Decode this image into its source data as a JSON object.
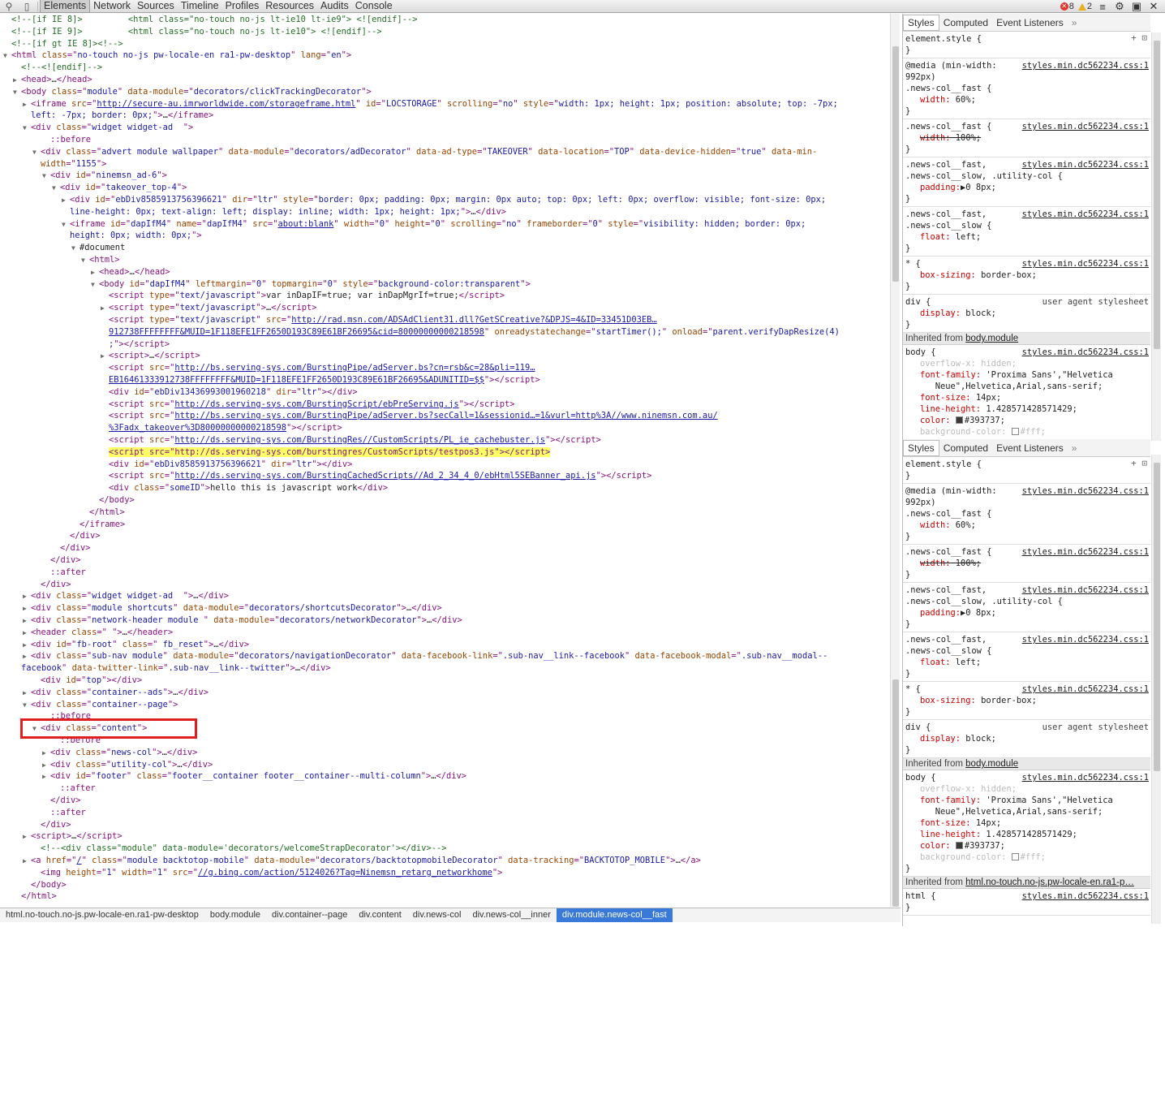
{
  "toolbar": {
    "tabs": [
      "Elements",
      "Network",
      "Sources",
      "Timeline",
      "Profiles",
      "Resources",
      "Audits",
      "Console"
    ],
    "errors": "8",
    "warnings": "2"
  },
  "tree": [
    {
      "t": 0,
      "i": 0,
      "h": "<span class=\"cmt\">&lt;!--[if IE 8]&gt;         &lt;html class=\"no-touch no-js lt-ie10 lt-ie9\"&gt; &lt;![endif]--&gt;</span>"
    },
    {
      "t": 0,
      "i": 0,
      "h": "<span class=\"cmt\">&lt;!--[if IE 9]&gt;         &lt;html class=\"no-touch no-js lt-ie10\"&gt; &lt;![endif]--&gt;</span>"
    },
    {
      "t": 0,
      "i": 0,
      "h": "<span class=\"cmt\">&lt;!--[if gt IE 8]&gt;&lt;!--&gt;</span>"
    },
    {
      "t": 2,
      "i": 0,
      "h": "&lt;html <span class=\"an\">class</span>=\"<span class=\"av\">no-touch no-js pw-locale-en ra1-pw-desktop</span>\" <span class=\"an\">lang</span>=\"<span class=\"av\">en</span>\"&gt;"
    },
    {
      "t": 0,
      "i": 1,
      "h": "<span class=\"cmt\">&lt;!--&lt;![endif]--&gt;</span>"
    },
    {
      "t": 1,
      "i": 1,
      "h": "&lt;head&gt;<span class=\"txt\">…</span>&lt;/head&gt;"
    },
    {
      "t": 2,
      "i": 1,
      "h": "&lt;body <span class=\"an\">class</span>=\"<span class=\"av\">module</span>\" <span class=\"an\">data-module</span>=\"<span class=\"av\">decorators/clickTrackingDecorator</span>\"&gt;"
    },
    {
      "t": 1,
      "i": 2,
      "h": "&lt;iframe <span class=\"an\">src</span>=\"<span class=\"lnk\">http://secure-au.imrworldwide.com/storageframe.html</span>\" <span class=\"an\">id</span>=\"<span class=\"av\">LOCSTORAGE</span>\" <span class=\"an\">scrolling</span>=\"<span class=\"av\">no</span>\" <span class=\"an\">style</span>=\"<span class=\"av\">width: 1px; height: 1px; position: absolute; top: -7px;</span>"
    },
    {
      "t": 0,
      "i": 2,
      "h": "<span class=\"av\">left: -7px; border: 0px;</span>\"&gt;<span class=\"txt\">…</span>&lt;/iframe&gt;"
    },
    {
      "t": 2,
      "i": 2,
      "h": "&lt;div <span class=\"an\">class</span>=\"<span class=\"av\">widget widget-ad  </span>\"&gt;"
    },
    {
      "t": 0,
      "i": 4,
      "h": "<span class=\"pseudo\">::before</span>"
    },
    {
      "t": 2,
      "i": 3,
      "h": "&lt;div <span class=\"an\">class</span>=\"<span class=\"av\">advert module wallpaper</span>\" <span class=\"an\">data-module</span>=\"<span class=\"av\">decorators/adDecorator</span>\" <span class=\"an\">data-ad-type</span>=\"<span class=\"av\">TAKEOVER</span>\" <span class=\"an\">data-location</span>=\"<span class=\"av\">TOP</span>\" <span class=\"an\">data-device-hidden</span>=\"<span class=\"av\">true</span>\" <span class=\"an\">data-min-</span>"
    },
    {
      "t": 0,
      "i": 3,
      "h": "<span class=\"an\">width</span>=\"<span class=\"av\">1155</span>\"&gt;"
    },
    {
      "t": 2,
      "i": 4,
      "h": "&lt;div <span class=\"an\">id</span>=\"<span class=\"av\">ninemsn_ad-6</span>\"&gt;"
    },
    {
      "t": 2,
      "i": 5,
      "h": "&lt;div <span class=\"an\">id</span>=\"<span class=\"av\">takeover_top-4</span>\"&gt;"
    },
    {
      "t": 1,
      "i": 6,
      "h": "&lt;div <span class=\"an\">id</span>=\"<span class=\"av\">ebDiv8585913756396621</span>\" <span class=\"an\">dir</span>=\"<span class=\"av\">ltr</span>\" <span class=\"an\">style</span>=\"<span class=\"av\">border: 0px; padding: 0px; margin: 0px auto; top: 0px; left: 0px; overflow: visible; font-size: 0px;</span>"
    },
    {
      "t": 0,
      "i": 6,
      "h": "<span class=\"av\">line-height: 0px; text-align: left; display: inline; width: 1px; height: 1px;</span>\"&gt;<span class=\"txt\">…</span>&lt;/div&gt;"
    },
    {
      "t": 2,
      "i": 6,
      "h": "&lt;iframe <span class=\"an\">id</span>=\"<span class=\"av\">dapIfM4</span>\" <span class=\"an\">name</span>=\"<span class=\"av\">dapIfM4</span>\" <span class=\"an\">src</span>=\"<span class=\"lnk\">about:blank</span>\" <span class=\"an\">width</span>=\"<span class=\"av\">0</span>\" <span class=\"an\">height</span>=\"<span class=\"av\">0</span>\" <span class=\"an\">scrolling</span>=\"<span class=\"av\">no</span>\" <span class=\"an\">frameborder</span>=\"<span class=\"av\">0</span>\" <span class=\"an\">style</span>=\"<span class=\"av\">visibility: hidden; border: 0px;</span>"
    },
    {
      "t": 0,
      "i": 6,
      "h": "<span class=\"av\">height: 0px; width: 0px;</span>\"&gt;"
    },
    {
      "t": 2,
      "i": 7,
      "h": "<span class=\"txt\">#document</span>"
    },
    {
      "t": 2,
      "i": 8,
      "h": "&lt;html&gt;"
    },
    {
      "t": 1,
      "i": 9,
      "h": "&lt;head&gt;<span class=\"txt\">…</span>&lt;/head&gt;"
    },
    {
      "t": 2,
      "i": 9,
      "h": "&lt;body <span class=\"an\">id</span>=\"<span class=\"av\">dapIfM4</span>\" <span class=\"an\">leftmargin</span>=\"<span class=\"av\">0</span>\" <span class=\"an\">topmargin</span>=\"<span class=\"av\">0</span>\" <span class=\"an\">style</span>=\"<span class=\"av\">background-color:transparent</span>\"&gt;"
    },
    {
      "t": 0,
      "i": 10,
      "h": "&lt;script <span class=\"an\">type</span>=\"<span class=\"av\">text/javascript</span>\"&gt;<span class=\"txt\">var inDapIF=true; var inDapMgrIf=true;</span>&lt;/script&gt;"
    },
    {
      "t": 1,
      "i": 10,
      "h": "&lt;script <span class=\"an\">type</span>=\"<span class=\"av\">text/javascript</span>\"&gt;<span class=\"txt\">…</span>&lt;/script&gt;"
    },
    {
      "t": 0,
      "i": 10,
      "h": "&lt;script <span class=\"an\">type</span>=\"<span class=\"av\">text/javascript</span>\" <span class=\"an\">src</span>=\"<span class=\"lnk\">http://rad.msn.com/ADSAdClient31.dll?GetSCreative?&amp;DPJS=4&amp;ID=33451D03EB…</span>"
    },
    {
      "t": 0,
      "i": 10,
      "h": "<span class=\"lnk\">912738FFFFFFFF&amp;MUID=1F118EFE1FF2650D193C89E61BF26695&amp;cid=80000000000218598</span>\" <span class=\"an\">onreadystatechange</span>=\"<span class=\"av\">startTimer();</span>\" <span class=\"an\">onload</span>=\"<span class=\"av\">parent.verifyDapResize(4)</span>"
    },
    {
      "t": 0,
      "i": 10,
      "h": "<span class=\"av\">;</span>\"&gt;&lt;/script&gt;"
    },
    {
      "t": 1,
      "i": 10,
      "h": "&lt;script&gt;<span class=\"txt\">…</span>&lt;/script&gt;"
    },
    {
      "t": 0,
      "i": 10,
      "h": "&lt;script <span class=\"an\">src</span>=\"<span class=\"lnk\">http://bs.serving-sys.com/BurstingPipe/adServer.bs?cn=rsb&amp;c=28&amp;pli=119…</span>"
    },
    {
      "t": 0,
      "i": 10,
      "h": "<span class=\"lnk\">EB16461333912738FFFFFFFF&amp;MUID=1F118EFE1FF2650D193C89E61BF26695&amp;ADUNITID=$$</span>\"&gt;&lt;/script&gt;"
    },
    {
      "t": 0,
      "i": 10,
      "h": "&lt;div <span class=\"an\">id</span>=\"<span class=\"av\">ebDiv13436993001960218</span>\" <span class=\"an\">dir</span>=\"<span class=\"av\">ltr</span>\"&gt;&lt;/div&gt;"
    },
    {
      "t": 0,
      "i": 10,
      "h": "&lt;script <span class=\"an\">src</span>=\"<span class=\"lnk\">http://ds.serving-sys.com/BurstingScript/ebPreServing.js</span>\"&gt;&lt;/script&gt;"
    },
    {
      "t": 0,
      "i": 10,
      "h": "&lt;script <span class=\"an\">src</span>=\"<span class=\"lnk\">http://bs.serving-sys.com/BurstingPipe/adServer.bs?secCall=1&amp;sessionid…=1&amp;vurl=http%3A//www.ninemsn.com.au/</span>"
    },
    {
      "t": 0,
      "i": 10,
      "h": "<span class=\"lnk\">%3Fadx_takeover%3D80000000000218598</span>\"&gt;&lt;/script&gt;"
    },
    {
      "t": 0,
      "i": 10,
      "h": "&lt;script <span class=\"an\">src</span>=\"<span class=\"lnk\">http://ds.serving-sys.com/BurstingRes//CustomScripts/PL_ie_cachebuster.js</span>\"&gt;&lt;/script&gt;"
    },
    {
      "t": 0,
      "i": 10,
      "h": "<span class=\"hl\">&lt;script src=\"http://ds.serving-sys.com/burstingres/CustomScripts/testpos3.js\"&gt;&lt;/script&gt;</span>"
    },
    {
      "t": 0,
      "i": 10,
      "h": "&lt;div <span class=\"an\">id</span>=\"<span class=\"av\">ebDiv8585913756396621</span>\" <span class=\"an\">dir</span>=\"<span class=\"av\">ltr</span>\"&gt;&lt;/div&gt;"
    },
    {
      "t": 0,
      "i": 10,
      "h": "&lt;script <span class=\"an\">src</span>=\"<span class=\"lnk\">http://ds.serving-sys.com/BurstingCachedScripts//Ad_2_34_4_0/ebHtml5SEBanner_api.js</span>\"&gt;&lt;/script&gt;"
    },
    {
      "t": 0,
      "i": 10,
      "h": "&lt;div <span class=\"an\">class</span>=\"<span class=\"av\">someID</span>\"&gt;<span class=\"txt\">hello this is javascript work</span>&lt;/div&gt;"
    },
    {
      "t": 0,
      "i": 9,
      "h": "&lt;/body&gt;"
    },
    {
      "t": 0,
      "i": 8,
      "h": "&lt;/html&gt;"
    },
    {
      "t": 0,
      "i": 7,
      "h": "&lt;/iframe&gt;"
    },
    {
      "t": 0,
      "i": 6,
      "h": "&lt;/div&gt;"
    },
    {
      "t": 0,
      "i": 5,
      "h": "&lt;/div&gt;"
    },
    {
      "t": 0,
      "i": 4,
      "h": "&lt;/div&gt;"
    },
    {
      "t": 0,
      "i": 4,
      "h": "<span class=\"pseudo\">::after</span>"
    },
    {
      "t": 0,
      "i": 3,
      "h": "&lt;/div&gt;"
    },
    {
      "t": 1,
      "i": 2,
      "h": "&lt;div <span class=\"an\">class</span>=\"<span class=\"av\">widget widget-ad  </span>\"&gt;<span class=\"txt\">…</span>&lt;/div&gt;"
    },
    {
      "t": 1,
      "i": 2,
      "h": "&lt;div <span class=\"an\">class</span>=\"<span class=\"av\">module shortcuts</span>\" <span class=\"an\">data-module</span>=\"<span class=\"av\">decorators/shortcutsDecorator</span>\"&gt;<span class=\"txt\">…</span>&lt;/div&gt;"
    },
    {
      "t": 1,
      "i": 2,
      "h": "&lt;div <span class=\"an\">class</span>=\"<span class=\"av\">network-header module </span>\" <span class=\"an\">data-module</span>=\"<span class=\"av\">decorators/networkDecorator</span>\"&gt;<span class=\"txt\">…</span>&lt;/div&gt;"
    },
    {
      "t": 1,
      "i": 2,
      "h": "&lt;header <span class=\"an\">class</span>=\"<span class=\"av\"> </span>\"&gt;<span class=\"txt\">…</span>&lt;/header&gt;"
    },
    {
      "t": 1,
      "i": 2,
      "h": "&lt;div <span class=\"an\">id</span>=\"<span class=\"av\">fb-root</span>\" <span class=\"an\">class</span>=\"<span class=\"av\"> fb_reset</span>\"&gt;<span class=\"txt\">…</span>&lt;/div&gt;"
    },
    {
      "t": 1,
      "i": 2,
      "h": "&lt;div <span class=\"an\">class</span>=\"<span class=\"av\">sub-nav module</span>\" <span class=\"an\">data-module</span>=\"<span class=\"av\">decorators/navigationDecorator</span>\" <span class=\"an\">data-facebook-link</span>=\"<span class=\"av\">.sub-nav__link--facebook</span>\" <span class=\"an\">data-facebook-modal</span>=\"<span class=\"av\">.sub-nav__modal--</span>"
    },
    {
      "t": 0,
      "i": 1,
      "h": "<span class=\"av\">facebook</span>\" <span class=\"an\">data-twitter-link</span>=\"<span class=\"av\">.sub-nav__link--twitter</span>\"&gt;<span class=\"txt\">…</span>&lt;/div&gt;"
    },
    {
      "t": 0,
      "i": 3,
      "h": "&lt;div <span class=\"an\">id</span>=\"<span class=\"av\">top</span>\"&gt;&lt;/div&gt;"
    },
    {
      "t": 1,
      "i": 2,
      "h": "&lt;div <span class=\"an\">class</span>=\"<span class=\"av\">container--ads</span>\"&gt;<span class=\"txt\">…</span>&lt;/div&gt;"
    },
    {
      "t": 2,
      "i": 2,
      "h": "&lt;div <span class=\"an\">class</span>=\"<span class=\"av\">container--page</span>\"&gt;"
    },
    {
      "t": 0,
      "i": 4,
      "h": "<span class=\"pseudo\">::before</span>"
    },
    {
      "t": 2,
      "i": 3,
      "h": "&lt;div <span class=\"an\">class</span>=\"<span class=\"av\">content</span>\"&gt;"
    },
    {
      "t": 0,
      "i": 5,
      "h": "<span class=\"pseudo\">::before</span>"
    },
    {
      "t": 1,
      "i": 4,
      "h": "&lt;div <span class=\"an\">class</span>=\"<span class=\"av\">news-col</span>\"&gt;<span class=\"txt\">…</span>&lt;/div&gt;"
    },
    {
      "t": 1,
      "i": 4,
      "h": "&lt;div <span class=\"an\">class</span>=\"<span class=\"av\">utility-col</span>\"&gt;<span class=\"txt\">…</span>&lt;/div&gt;"
    },
    {
      "t": 1,
      "i": 4,
      "h": "&lt;div <span class=\"an\">id</span>=\"<span class=\"av\">footer</span>\" <span class=\"an\">class</span>=\"<span class=\"av\">footer__container footer__container--multi-column</span>\"&gt;<span class=\"txt\">…</span>&lt;/div&gt;"
    },
    {
      "t": 0,
      "i": 5,
      "h": "<span class=\"pseudo\">::after</span>"
    },
    {
      "t": 0,
      "i": 4,
      "h": "&lt;/div&gt;"
    },
    {
      "t": 0,
      "i": 4,
      "h": "<span class=\"pseudo\">::after</span>"
    },
    {
      "t": 0,
      "i": 3,
      "h": "&lt;/div&gt;"
    },
    {
      "t": 1,
      "i": 2,
      "h": "&lt;script&gt;<span class=\"txt\">…</span>&lt;/script&gt;"
    },
    {
      "t": 0,
      "i": 3,
      "h": "<span class=\"cmt\">&lt;!--&lt;div class=\"module\" data-module='decorators/welcomeStrapDecorator'&gt;&lt;/div&gt;--&gt;</span>"
    },
    {
      "t": 1,
      "i": 2,
      "h": "&lt;a <span class=\"an\">href</span>=\"<span class=\"lnk\">/</span>\" <span class=\"an\">class</span>=\"<span class=\"av\">module backtotop-mobile</span>\" <span class=\"an\">data-module</span>=\"<span class=\"av\">decorators/backtotopmobileDecorator</span>\" <span class=\"an\">data-tracking</span>=\"<span class=\"av\">BACKTOTOP_MOBILE</span>\"&gt;<span class=\"txt\">…</span>&lt;/a&gt;"
    },
    {
      "t": 0,
      "i": 3,
      "h": "&lt;img <span class=\"an\">height</span>=\"<span class=\"av\">1</span>\" <span class=\"an\">width</span>=\"<span class=\"av\">1</span>\" <span class=\"an\">src</span>=\"<span class=\"lnk\">//g.bing.com/action/5124026?Tag=Ninemsn_retarg_networkhome</span>\"&gt;"
    },
    {
      "t": 0,
      "i": 2,
      "h": "&lt;/body&gt;"
    },
    {
      "t": 0,
      "i": 1,
      "h": "&lt;/html&gt;"
    }
  ],
  "breadcrumbs": [
    "html.no-touch.no-js.pw-locale-en.ra1-pw-desktop",
    "body.module",
    "div.container--page",
    "div.content",
    "div.news-col",
    "div.news-col__inner",
    "div.module.news-col__fast"
  ],
  "styles_tabs": [
    "Styles",
    "Computed",
    "Event Listeners",
    "»"
  ],
  "styles": {
    "src": "styles.min.dc562234.css:1",
    "ua": "user agent stylesheet",
    "inherited_from_label": "Inherited from",
    "inherited_body": "body.module",
    "inherited_html": "html.no-touch.no-js.pw-locale-en.ra1-p…",
    "element_style": "element.style {",
    "close": "}",
    "media": "@media (min-width:\n992px)",
    "sel_fast": ".news-col__fast {",
    "sel_fast_slow_util": ".news-col__fast,\n.news-col__slow, .utility-col {",
    "sel_fast_slow": ".news-col__fast,\n.news-col__slow {",
    "sel_star": "* {",
    "sel_div": "div {",
    "sel_body": "body {",
    "sel_html": "html {",
    "p_width60": "width: 60%;",
    "p_width100": "width: 100%;",
    "p_padding": "padding:▶0 8px;",
    "p_float": "float: left;",
    "p_boxsizing": "box-sizing: border-box;",
    "p_display": "display: block;",
    "p_overflowx": "overflow-x: hidden;",
    "p_fontfamily": "font-family: 'Proxima Sans',\"Helvetica\n   Neue\",Helvetica,Arial,sans-serif;",
    "p_fontsize": "font-size: 14px;",
    "p_lineheight": "line-height: 1.428571428571429;",
    "p_color": "#393737;",
    "p_color_name": "color:",
    "p_bg": "#fff;",
    "p_bg_name": "background-color:"
  }
}
